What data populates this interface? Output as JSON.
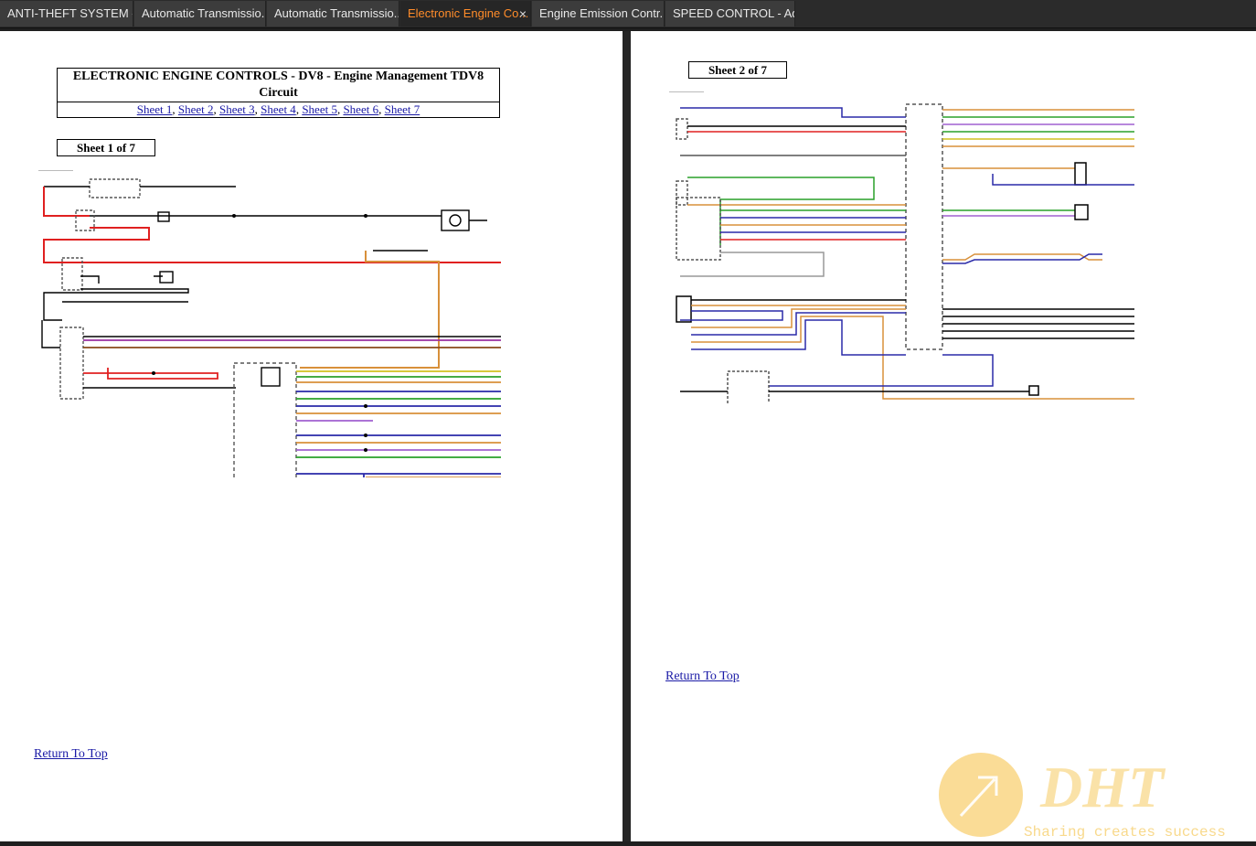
{
  "tabs": [
    {
      "label": "ANTI-THEFT SYSTEM - ...",
      "active": false
    },
    {
      "label": "Automatic Transmissio...",
      "active": false
    },
    {
      "label": "Automatic Transmissio...",
      "active": false
    },
    {
      "label": "Electronic Engine Co...",
      "active": true
    },
    {
      "label": "Engine Emission Contr...",
      "active": false
    },
    {
      "label": "SPEED CONTROL - Ada...",
      "active": false
    }
  ],
  "close_glyph": "×",
  "left_pane": {
    "title": "ELECTRONIC ENGINE CONTROLS - DV8 - Engine Management TDV8 Circuit",
    "sheet_links": [
      "Sheet 1",
      "Sheet 2",
      "Sheet 3",
      "Sheet 4",
      "Sheet 5",
      "Sheet 6",
      "Sheet 7"
    ],
    "sheet_label": "Sheet 1 of 7",
    "return_to_top": "Return To Top"
  },
  "right_pane": {
    "sheet_label": "Sheet 2 of 7",
    "return_to_top": "Return To Top"
  },
  "watermark": {
    "logo_text": "DHT",
    "tagline": "Sharing creates success"
  },
  "colors": {
    "active_tab": "#ff8c2a",
    "link": "#1a1aa6",
    "wire_red": "#e02020",
    "wire_orange": "#d8903a",
    "wire_blue": "#2a2aa8",
    "wire_green": "#2aa02a",
    "wire_purple": "#a060d0",
    "wire_brown": "#8a4a1a",
    "wire_yellow": "#d0c020",
    "watermark": "#f5c040"
  }
}
